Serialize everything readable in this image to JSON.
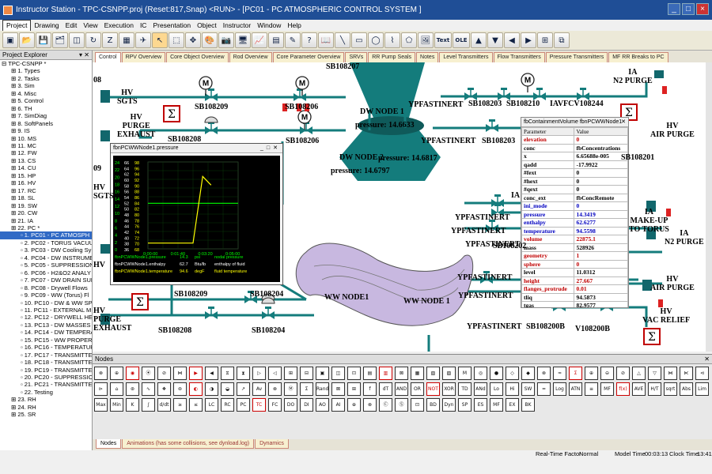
{
  "window": {
    "title": "Instructor Station - TPC-CSNPP.proj (Reset:817,Snap) <RUN> - [PC01 - PC ATMOSPHERIC CONTROL SYSTEM ]"
  },
  "menu": [
    "Project",
    "Drawing",
    "Edit",
    "View",
    "Execution",
    "IC",
    "Presentation",
    "Object",
    "Instructor",
    "Window",
    "Help"
  ],
  "toolbar": {
    "buttons": [
      "new-icon",
      "open-icon",
      "save-icon",
      "save-all-icon",
      "nodes-icon",
      "refresh-icon",
      "z-icon",
      "grid-icon",
      "plane-icon",
      "arrow-icon",
      "select-icon",
      "pan-icon",
      "color-icon",
      "camera-icon",
      "monitor-icon",
      "trend-icon",
      "chart-icon",
      "tools-icon",
      "help-icon",
      "book-icon",
      "line-icon",
      "rect-icon",
      "ellipse-icon",
      "polyline-icon",
      "polygon-icon",
      "image-icon",
      "text-icon",
      "ole-icon",
      "arrow-up-icon",
      "arrow-down-icon",
      "arrow-left-icon",
      "arrow-right-icon",
      "align-icon",
      "front-icon"
    ],
    "text_label": "Text",
    "ole_label": "OLE"
  },
  "explorer": {
    "title": "Project Explorer",
    "items": [
      "TPC-CSNPP *",
      "1. Types",
      "2. Tasks",
      "3. Sim",
      "4. Misc",
      "5. Control",
      "6. TH",
      "7. SimDiag",
      "8. SoftPanels",
      "9. IS",
      "10. MS",
      "11. MC",
      "12. FW",
      "13. CS",
      "14. CU",
      "15. HP",
      "16. HV",
      "17. RC",
      "18. SL",
      "19. SW",
      "20. CW",
      "21. IA",
      "22. PC *",
      "1. PC01 - PC ATMOSPH",
      "2. PC02 - TORUS VACUU",
      "3. PC03 - DW Cooling Sy",
      "4. PC04 - DW INSTRUME",
      "5. PC05 - SUPPRESSION",
      "6. PC06 - H2&O2 ANALY",
      "7. PC07 - DW DRAIN SUN",
      "8. PC08 - Drywell Flows",
      "9. PC09 - WW (Torus) Fl",
      "10. PC10 - DW & WW SP",
      "11. PC11 - EXTERNAL M",
      "12. PC12 - DRYWELL  HE",
      "13. PC13 - DW MASSES",
      "14. PC14 - DW TEMPERA",
      "15. PC15 - WW PROPERT",
      "16. PC16 - TEMPERATUR",
      "17. PC17 - TRANSMITTE",
      "18. PC18 - TRANSMITTE",
      "19. PC19 - TRANSMITTE",
      "20. PC20 - SUPPRESSION",
      "21. PC21 - TRANSMITTE",
      "22. Testing",
      "23. RH",
      "24. RH",
      "25. SR"
    ],
    "selected_index": 23
  },
  "tabs": [
    "Control",
    "RPV Overview",
    "Core Object Overview",
    "Rod Overview",
    "Core Parameter Overview",
    "SRVs",
    "RR Pump Seals",
    "Notes",
    "Level Transmitters",
    "Flow Transmitters",
    "Pressure Transmitters",
    "MF RR Breaks to PC"
  ],
  "diagram": {
    "labels": {
      "d08": "08",
      "d09": "09",
      "hv_sgts": "HV\nSGTS",
      "hv_purge_exhaust": "HV\nPURGE\nEXHAUST",
      "hv_sgts2": "HV\nSGTS",
      "hv_purge_exhaust2": "HV\nPURGE\nEXHAUST",
      "hv_air_purge": "HV\nAIR PURGE",
      "hv_air_purge2": "HV\nAIR PURGE",
      "hv_vac_relief": "HV\nVAC RELIEF",
      "ia_n2_purge": "IA\nN2 PURGE",
      "ia_n2_purge2": "IA\nN2 PURGE",
      "ia_makeup": "IA\nMAKE-UP\nTO TORUS",
      "dw_node1": "DW NODE 1",
      "dw_node2": "DW NODE 2",
      "ww_node1a": "WW NODE1",
      "ww_node1b": "WW NODE 1",
      "pressure1": "pressure: 14.6633",
      "pressure2": "pressure: 14.6817",
      "pressure3": "pressure: 14.6797",
      "sb108207": "SB108207",
      "sb108209": "SB108209",
      "sb108206a": "SB108206",
      "sb108208": "SB108208",
      "sb108206b": "SB108206",
      "sb108203a": "SB108203",
      "sb108210": "SB108210",
      "iavfcv": "IAVFCV108244",
      "sb108203b": "SB108203",
      "sb108201": "SB108201",
      "sb108202": "SB108202",
      "sb108209b": "SB108209",
      "sb108204a": "SB108204",
      "sb108208b": "SB108208",
      "sb108204b": "SB108204",
      "sb108200b": "SB108200B",
      "v108200b": "V108200B",
      "ypf1": "YPFASTINERT",
      "ypf2": "YPFASTINERT",
      "ypf3": "YPFASTINERT",
      "ypf4": "YPFASTINERT",
      "ypf5": "YPFASTINERT",
      "ypf6": "YPFASTINERT",
      "ypf7": "YPFASTINERT",
      "ypf8": "YPFASTINERT",
      "ia_label": "IA",
      "m_symbol": "M",
      "sigma": "Σ",
      "hv_short": "HV"
    }
  },
  "trend": {
    "title": "fbnPCWWNode1.pressure",
    "left_axis": [
      "24",
      "22",
      "20",
      "18",
      "16",
      "14",
      "12",
      "10",
      "8",
      "6",
      "4",
      "2",
      "0"
    ],
    "mid_axis": [
      "66",
      "64",
      "62",
      "60",
      "58",
      "56",
      "54",
      "52",
      "50",
      "48",
      "46",
      "44",
      "42",
      "40",
      "38",
      "36"
    ],
    "right_axis": [
      "98",
      "96",
      "94",
      "92",
      "90",
      "88",
      "86",
      "84",
      "82",
      "80",
      "78",
      "76",
      "74",
      "72",
      "70",
      "68"
    ],
    "time_axis": [
      "0:00:00",
      "0:01:40",
      "0:03:20",
      "0:05:00"
    ],
    "legend": [
      {
        "name": "fbnPCWWNode1.pressure",
        "value": "14.3",
        "unit": "psi",
        "desc": "nodal pressure",
        "color": "#00ff00"
      },
      {
        "name": "fbnPCWWNode1.enthalpy",
        "value": "62.7",
        "unit": "Btu/lb",
        "desc": "enthalpy of fluid",
        "color": "#ffffff"
      },
      {
        "name": "fbnPCWWNode1.temperature",
        "value": "94.6",
        "unit": "degF",
        "desc": "fluid temperature",
        "color": "#ffff00"
      }
    ]
  },
  "chart_data": {
    "type": "line",
    "title": "fbnPCWWNode1.pressure",
    "x_label": "",
    "x": [
      "0:00:00",
      "0:01:40",
      "0:03:20",
      "0:05:00"
    ],
    "series": [
      {
        "name": "fbnPCWWNode1.pressure",
        "color": "#00ff00",
        "points": [
          [
            0,
            12.6
          ],
          [
            200,
            12.6
          ],
          [
            300,
            12.6
          ]
        ]
      },
      {
        "name": "fbnPCWWNode1.temperature",
        "color": "#ffff00",
        "points": [
          [
            0,
            70
          ],
          [
            150,
            70
          ],
          [
            182,
            93
          ],
          [
            210,
            90
          ]
        ]
      }
    ]
  },
  "properties": {
    "title": "fbContainmentVolume fbnPCWWNode1",
    "headers": [
      "Parameter",
      "Value"
    ],
    "rows": [
      {
        "p": "elevation",
        "v": "0",
        "pc": "#c00000",
        "vc": "#c00000"
      },
      {
        "p": "conc",
        "v": "fbConcentrations",
        "pc": "#000",
        "vc": "#000"
      },
      {
        "p": "x",
        "v": "6.65688e-005",
        "pc": "#000",
        "vc": "#000"
      },
      {
        "p": "qadd",
        "v": "-17.9922",
        "pc": "#000",
        "vc": "#000"
      },
      {
        "p": "#fext",
        "v": "0",
        "pc": "#000",
        "vc": "#000"
      },
      {
        "p": "#hext",
        "v": "0",
        "pc": "#000",
        "vc": "#000"
      },
      {
        "p": "#qext",
        "v": "0",
        "pc": "#000",
        "vc": "#000"
      },
      {
        "p": "conc_ext",
        "v": "fbConcRemote",
        "pc": "#000",
        "vc": "#000"
      },
      {
        "p": "ini_mode",
        "v": "0",
        "pc": "#0000c0",
        "vc": "#0000c0"
      },
      {
        "p": "pressure",
        "v": "14.3419",
        "pc": "#0000c0",
        "vc": "#0000c0"
      },
      {
        "p": "enthalpy",
        "v": "62.6277",
        "pc": "#0000c0",
        "vc": "#0000c0"
      },
      {
        "p": "temperature",
        "v": "94.5598",
        "pc": "#0000c0",
        "vc": "#0000c0"
      },
      {
        "p": "volume",
        "v": "22875.1",
        "pc": "#c00000",
        "vc": "#c00000"
      },
      {
        "p": "mass",
        "v": "528926",
        "pc": "#000",
        "vc": "#000"
      },
      {
        "p": "geometry",
        "v": "1",
        "pc": "#c00000",
        "vc": "#c00000"
      },
      {
        "p": "sphere",
        "v": "0",
        "pc": "#c00000",
        "vc": "#c00000"
      },
      {
        "p": "level",
        "v": "11.0312",
        "pc": "#000",
        "vc": "#000"
      },
      {
        "p": "height",
        "v": "27.667",
        "pc": "#c00000",
        "vc": "#c00000"
      },
      {
        "p": "flanges_protrude",
        "v": "0.01",
        "pc": "#c00000",
        "vc": "#c00000"
      },
      {
        "p": "tliq",
        "v": "94.5873",
        "pc": "#000",
        "vc": "#000"
      },
      {
        "p": "tgas",
        "v": "82.9577",
        "pc": "#000",
        "vc": "#000"
      }
    ]
  },
  "nodes_panel": {
    "title": "Nodes",
    "buttons": [
      "⊗",
      "⊕",
      "◉",
      "⦿",
      "⊘",
      "⋈",
      "▶",
      "◀",
      "⧖",
      "⧗",
      "▷",
      "◁",
      "⊞",
      "⊟",
      "▣",
      "◫",
      "⊡",
      "▤",
      "▥",
      "⊠",
      "▦",
      "▧",
      "▨",
      "M",
      "◎",
      "●",
      "◇",
      "◆",
      "⊗",
      "≈",
      "Σ",
      "⊕",
      "⊖",
      "⊘",
      "△",
      "▽",
      "⋈",
      "⋉",
      "⊲",
      "⊳",
      "⌂",
      "⊛",
      "∿",
      "❖",
      "⊚",
      "◐",
      "◑",
      "◒",
      "↗",
      "Av",
      "⊗",
      "Ⓜ",
      "Σ",
      "Rand",
      "⊠",
      "⊞",
      "f",
      "dT",
      "AND",
      "OR",
      "NOT",
      "XOR",
      "TD",
      "ANd",
      "Lo",
      "Hi",
      "SW",
      "=",
      "Log",
      "ATN",
      "≡",
      "MF",
      "f(x)",
      "AVE",
      "H/T",
      "sqrt",
      "Abs",
      "Lim",
      "Max",
      "Min",
      "K",
      "∫",
      "d/dt",
      "≥",
      "≤",
      "LC",
      "RC",
      "PC",
      "TC",
      "FC",
      "DO",
      "DI",
      "AO",
      "AI",
      "⊕",
      "⊗",
      "Ⓒ",
      "Ⓢ",
      "⊡",
      "BD",
      "Dyn",
      "SP",
      "ES",
      "MF",
      "EX",
      "BK"
    ],
    "red_buttons": [
      2,
      6,
      18,
      30,
      45,
      60,
      72,
      88
    ]
  },
  "bottom_tabs": [
    "Nodes",
    "Animations (has some collisions, see dynload.log)",
    "Dynamics"
  ],
  "status": {
    "rtf_label": "Real-Time Factor",
    "rtf_value": "Normal",
    "model_time_label": "Model Time",
    "model_time": "00:03:13",
    "clock_time_label": "Clock Time",
    "clock_time": "13:41:58"
  },
  "colors": {
    "pipe": "#147c7c",
    "valve": "#147c7c",
    "vessel": "#147c7c",
    "sigma_border": "#c00000",
    "dark_block": "#12676c"
  }
}
